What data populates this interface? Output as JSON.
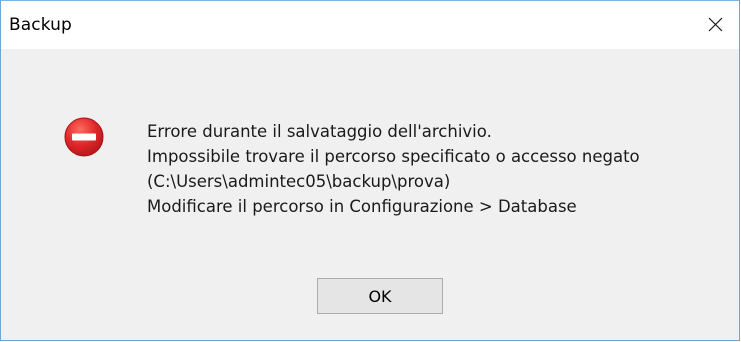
{
  "window": {
    "title": "Backup"
  },
  "icons": {
    "close": "close-icon",
    "error": "error-icon"
  },
  "message": {
    "lines": [
      "Errore durante il salvataggio dell'archivio.",
      "Impossibile trovare il percorso specificato o accesso negato",
      "(C:\\Users\\admintec05\\backup\\prova)",
      "Modificare il percorso in Configurazione > Database"
    ]
  },
  "buttons": {
    "ok_label": "OK"
  },
  "colors": {
    "error_red": "#e0272b",
    "dialog_background": "#f0f0f0",
    "button_background": "#e5e5e5"
  }
}
